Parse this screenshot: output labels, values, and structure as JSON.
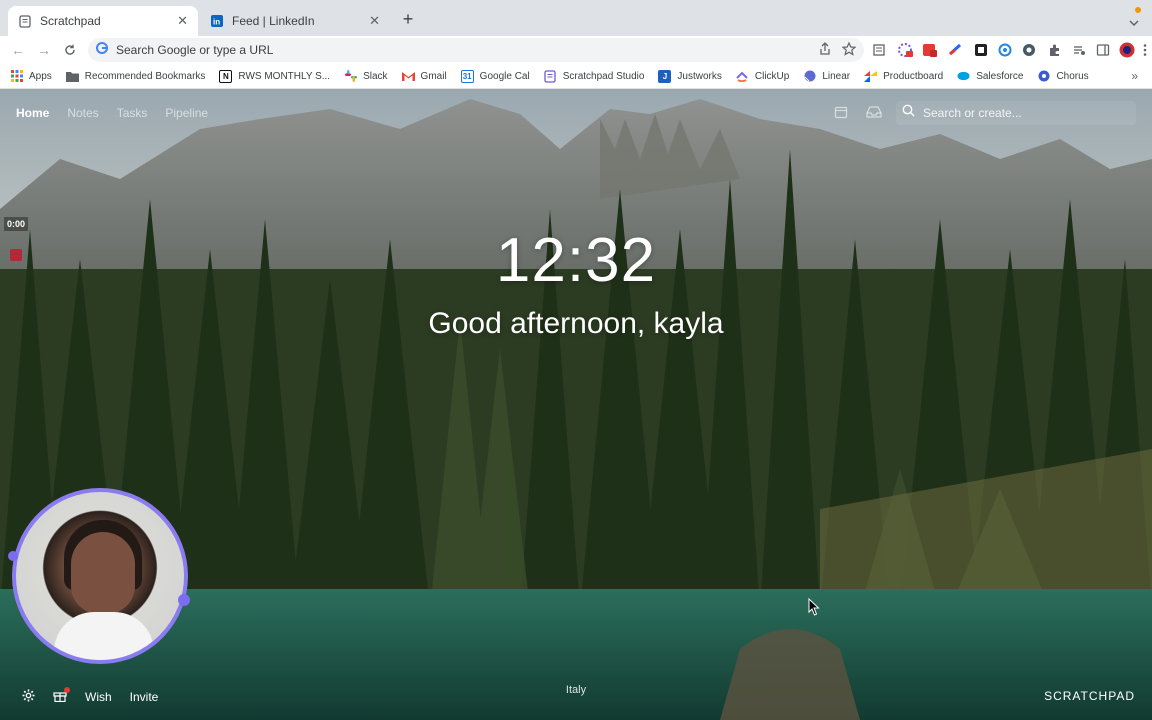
{
  "browser": {
    "tabs": [
      {
        "title": "Scratchpad",
        "active": true,
        "icon": "scratchpad-doc-icon"
      },
      {
        "title": "Feed | LinkedIn",
        "active": false,
        "icon": "linkedin-icon"
      }
    ],
    "omnibox": {
      "placeholder": "Search Google or type a URL"
    },
    "bookmarks": [
      {
        "label": "Apps",
        "icon": "apps-grid-icon",
        "color": "#5f6368"
      },
      {
        "label": "Recommended Bookmarks",
        "icon": "folder-icon",
        "color": "#5f6368"
      },
      {
        "label": "RWS MONTHLY S...",
        "icon": "notion-icon",
        "color": "#111111"
      },
      {
        "label": "Slack",
        "icon": "slack-icon",
        "color": "#4a154b"
      },
      {
        "label": "Gmail",
        "icon": "gmail-icon",
        "color": "#ea4335"
      },
      {
        "label": "Google Cal",
        "icon": "google-calendar-icon",
        "color": "#1a73e8"
      },
      {
        "label": "Scratchpad Studio",
        "icon": "scratchpad-icon",
        "color": "#6b5bd6"
      },
      {
        "label": "Justworks",
        "icon": "justworks-icon",
        "color": "#1f5fbf"
      },
      {
        "label": "ClickUp",
        "icon": "clickup-icon",
        "color": "#7b68ee"
      },
      {
        "label": "Linear",
        "icon": "linear-icon",
        "color": "#5e6ad2"
      },
      {
        "label": "Productboard",
        "icon": "productboard-icon",
        "color": "#e63946"
      },
      {
        "label": "Salesforce",
        "icon": "salesforce-icon",
        "color": "#00a1e0"
      },
      {
        "label": "Chorus",
        "icon": "chorus-icon",
        "color": "#3c5ccf"
      }
    ]
  },
  "app": {
    "nav": [
      {
        "label": "Home",
        "active": true
      },
      {
        "label": "Notes",
        "active": false
      },
      {
        "label": "Tasks",
        "active": false
      },
      {
        "label": "Pipeline",
        "active": false
      }
    ],
    "search_placeholder": "Search or create...",
    "recording_time": "0:00",
    "clock": "12:32",
    "greeting": "Good afternoon, kayla",
    "location": "Italy",
    "bottom": {
      "wish": "Wish",
      "invite": "Invite"
    },
    "brand": "SCRATCHPAD"
  },
  "colors": {
    "accent": "#8a7cf0",
    "record": "#b02a3a"
  }
}
